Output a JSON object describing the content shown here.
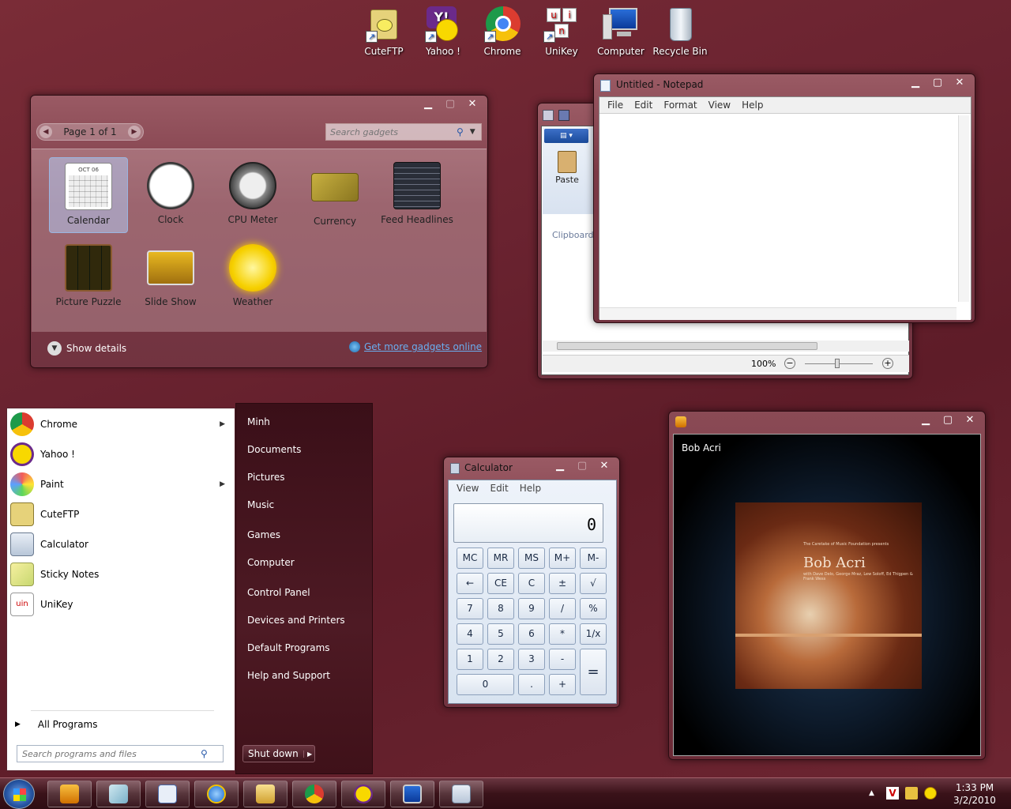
{
  "desktop_icons": [
    {
      "label": "CuteFTP",
      "icon": "cuteftp-icon"
    },
    {
      "label": "Yahoo !",
      "icon": "yahoo-messenger-icon"
    },
    {
      "label": "Chrome",
      "icon": "chrome-icon"
    },
    {
      "label": "UniKey",
      "icon": "unikey-icon"
    },
    {
      "label": "Computer",
      "icon": "computer-icon"
    },
    {
      "label": "Recycle Bin",
      "icon": "recycle-bin-icon"
    }
  ],
  "gadgets": {
    "pager": "Page 1 of 1",
    "search_placeholder": "Search gadgets",
    "items": [
      {
        "label": "Calendar"
      },
      {
        "label": "Clock"
      },
      {
        "label": "CPU Meter"
      },
      {
        "label": "Currency"
      },
      {
        "label": "Feed Headlines"
      },
      {
        "label": "Picture Puzzle"
      },
      {
        "label": "Slide Show"
      },
      {
        "label": "Weather"
      }
    ],
    "show_details": "Show details",
    "get_more": "Get more gadgets online",
    "calendar_month": "OCT 06"
  },
  "notepad": {
    "title": "Untitled - Notepad",
    "menu": [
      "File",
      "Edit",
      "Format",
      "View",
      "Help"
    ]
  },
  "wordpad": {
    "paste": "Paste",
    "clipboard": "Clipboard",
    "zoom": "100%"
  },
  "start_menu": {
    "programs": [
      {
        "label": "Chrome",
        "has_sub": true
      },
      {
        "label": "Yahoo !",
        "has_sub": false
      },
      {
        "label": "Paint",
        "has_sub": true
      },
      {
        "label": "CuteFTP",
        "has_sub": false
      },
      {
        "label": "Calculator",
        "has_sub": false
      },
      {
        "label": "Sticky Notes",
        "has_sub": false
      },
      {
        "label": "UniKey",
        "has_sub": false
      }
    ],
    "all_programs": "All Programs",
    "search_placeholder": "Search programs and files",
    "right": [
      "Minh",
      "Documents",
      "Pictures",
      "Music",
      "Games",
      "Computer",
      "Control Panel",
      "Devices and Printers",
      "Default Programs",
      "Help and Support"
    ],
    "shutdown": "Shut down"
  },
  "calculator": {
    "title": "Calculator",
    "menu": [
      "View",
      "Edit",
      "Help"
    ],
    "display": "0",
    "rows": [
      [
        "MC",
        "MR",
        "MS",
        "M+",
        "M-"
      ],
      [
        "←",
        "CE",
        "C",
        "±",
        "√"
      ],
      [
        "7",
        "8",
        "9",
        "/",
        "%"
      ],
      [
        "4",
        "5",
        "6",
        "*",
        "1/x"
      ],
      [
        "1",
        "2",
        "3",
        "-",
        "="
      ],
      [
        "0",
        ".",
        "+"
      ]
    ]
  },
  "media_player": {
    "artist": "Bob Acri",
    "album_title": "Bob Acri",
    "album_sub1": "The Caretake of Music Foundation presents",
    "album_sub2": "with Dave Delo, George Mraz, Lew Soloff, Ed Thigpen & Frank Wess"
  },
  "taskbar": {
    "buttons": [
      "windows-media-player-icon",
      "sticky-notes-icon",
      "wordpad-icon",
      "internet-explorer-icon",
      "windows-explorer-icon",
      "chrome-icon",
      "yahoo-messenger-icon",
      "remote-desktop-icon",
      "calculator-icon"
    ],
    "time": "1:33 PM",
    "date": "3/2/2010"
  }
}
